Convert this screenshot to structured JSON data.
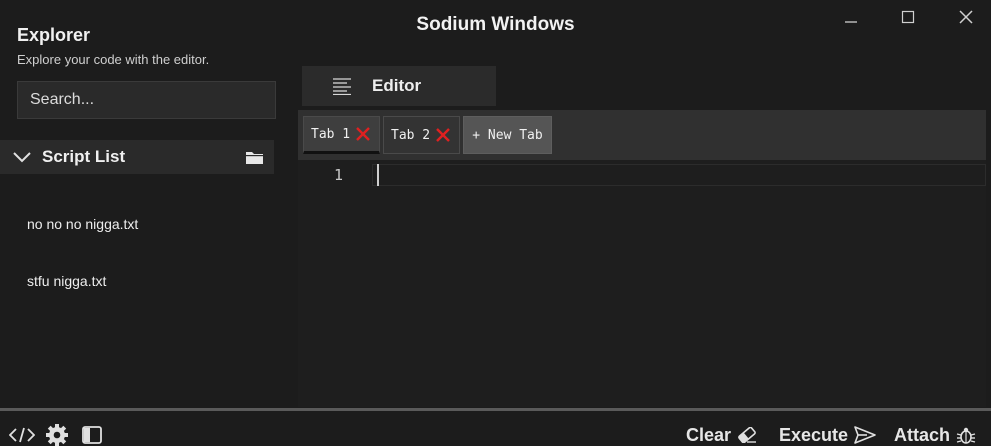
{
  "window": {
    "title": "Sodium Windows",
    "controls": [
      "minimize",
      "maximize",
      "close"
    ]
  },
  "explorer": {
    "title": "Explorer",
    "subtitle": "Explore your code with the editor.",
    "search_placeholder": "Search...",
    "script_list_label": "Script List",
    "scripts": [
      "no no no nigga.txt",
      "stfu nigga.txt"
    ]
  },
  "editor": {
    "header_label": "Editor",
    "tabs": [
      {
        "label": "Tab 1",
        "active": true
      },
      {
        "label": "Tab 2",
        "active": false
      }
    ],
    "new_tab_label": "+ New Tab",
    "line_numbers": [
      "1"
    ]
  },
  "actions": {
    "clear": "Clear",
    "execute": "Execute",
    "attach": "Attach"
  },
  "colors": {
    "background": "#1c1c1c",
    "panel": "#2a2a2a",
    "tab_active": "#3e3e3e",
    "tab_close": "#e02020",
    "text": "#eaeaea"
  }
}
